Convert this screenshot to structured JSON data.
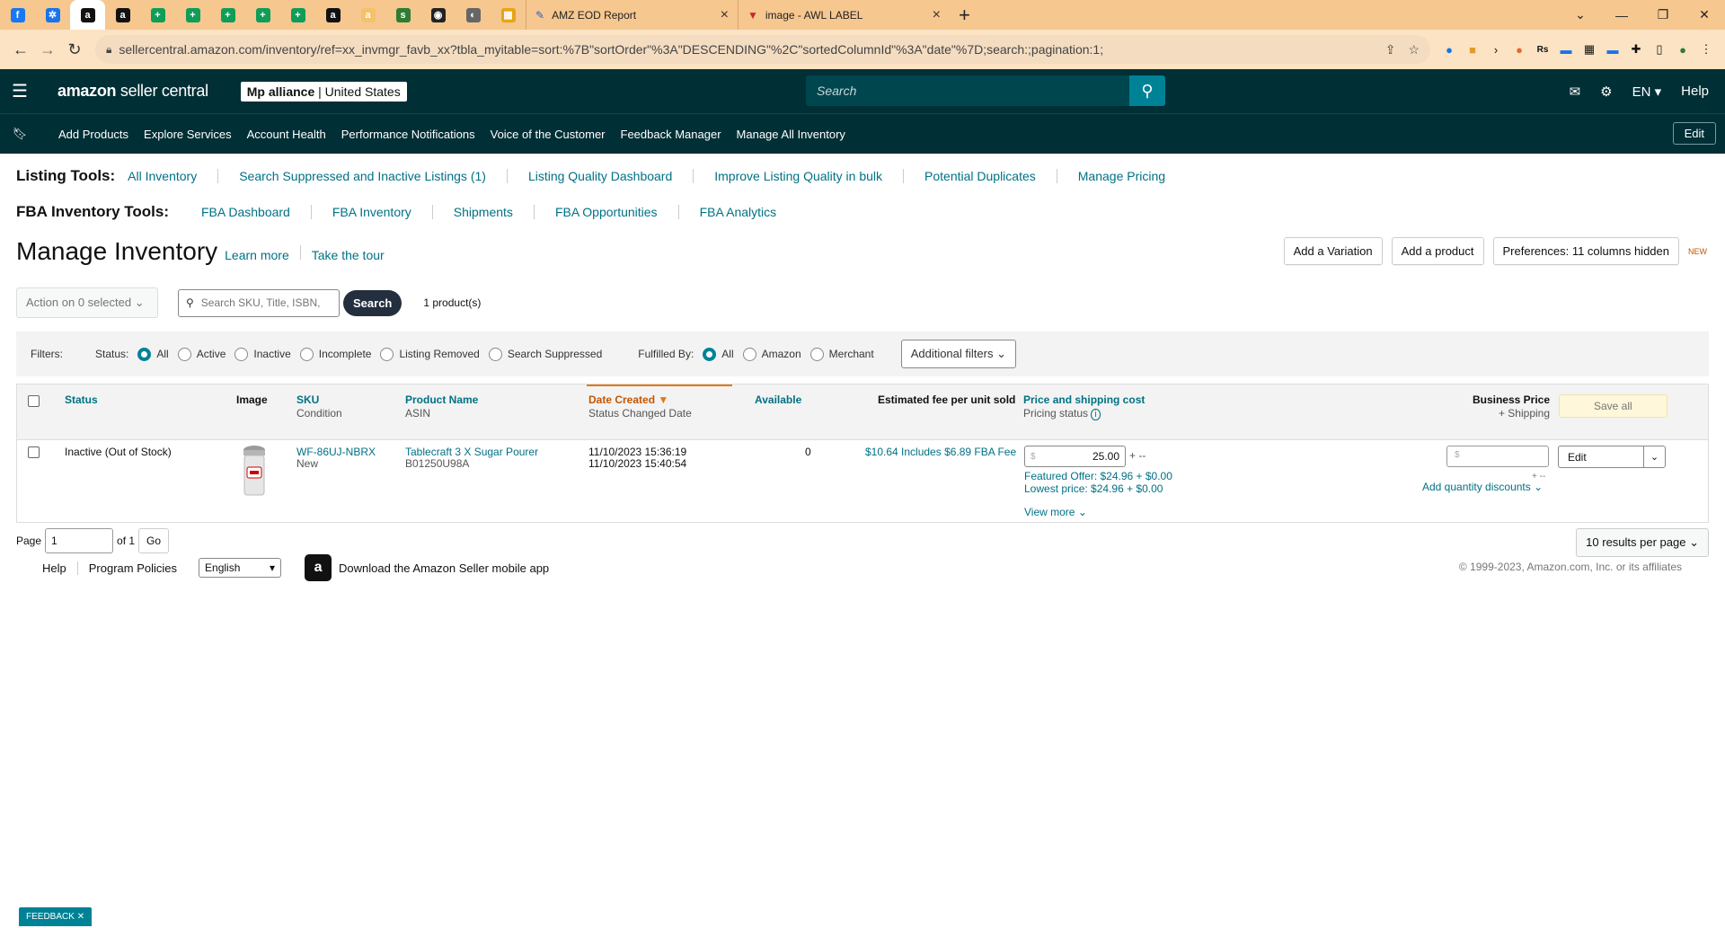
{
  "browser": {
    "tabs": [
      {
        "icon": "f",
        "color": "#1877f2"
      },
      {
        "icon": "✲",
        "color": "#1a73e8"
      },
      {
        "icon": "a",
        "color": "#111111",
        "active": true
      },
      {
        "icon": "a",
        "color": "#111111"
      },
      {
        "icon": "+",
        "color": "#0f9d58"
      },
      {
        "icon": "+",
        "color": "#0f9d58"
      },
      {
        "icon": "+",
        "color": "#0f9d58"
      },
      {
        "icon": "+",
        "color": "#0f9d58"
      },
      {
        "icon": "+",
        "color": "#0f9d58"
      },
      {
        "icon": "a",
        "color": "#111111"
      },
      {
        "icon": "a",
        "color": "#f5c26b"
      },
      {
        "icon": "s",
        "color": "#2e7d32"
      },
      {
        "icon": "◉",
        "color": "#222222"
      },
      {
        "icon": "◐",
        "color": "#666666"
      },
      {
        "icon": "▦",
        "color": "#e8a317"
      }
    ],
    "named_tabs": [
      {
        "title": "AMZ EOD Report"
      },
      {
        "title": "image - AWL LABEL"
      }
    ],
    "url": "sellercentral.amazon.com/inventory/ref=xx_invmgr_favb_xx?tbla_myitable=sort:%7B\"sortOrder\"%3A\"DESCENDING\"%2C\"sortedColumnId\"%3A\"date\"%7D;search:;pagination:1;"
  },
  "header": {
    "brand_bold": "amazon",
    "brand_light": "seller central",
    "store_name": "Mp alliance",
    "store_region": "United States",
    "search_placeholder": "Search",
    "lang": "EN",
    "help": "Help"
  },
  "subnav": {
    "items": [
      "Add Products",
      "Explore Services",
      "Account Health",
      "Performance Notifications",
      "Voice of the Customer",
      "Feedback Manager",
      "Manage All Inventory"
    ],
    "edit": "Edit"
  },
  "listing_tools": {
    "label": "Listing Tools:",
    "links": [
      "All Inventory",
      "Search Suppressed and Inactive Listings (1)",
      "Listing Quality Dashboard",
      "Improve Listing Quality in bulk",
      "Potential Duplicates",
      "Manage Pricing"
    ]
  },
  "fba_tools": {
    "label": "FBA Inventory Tools:",
    "links": [
      "FBA Dashboard",
      "FBA Inventory",
      "Shipments",
      "FBA Opportunities",
      "FBA Analytics"
    ]
  },
  "page": {
    "title": "Manage Inventory",
    "learn_more": "Learn more",
    "take_tour": "Take the tour",
    "add_variation": "Add a Variation",
    "add_product": "Add a product",
    "preferences": "Preferences: 11 columns hidden",
    "new_badge": "NEW"
  },
  "actions": {
    "action_select": "Action on 0 selected",
    "search_placeholder": "Search SKU, Title, ISBN,",
    "search_button": "Search",
    "product_count": "1 product(s)"
  },
  "filters": {
    "label": "Filters:",
    "status_label": "Status:",
    "status_options": [
      "All",
      "Active",
      "Inactive",
      "Incomplete",
      "Listing Removed",
      "Search Suppressed"
    ],
    "fulfilled_label": "Fulfilled By:",
    "fulfilled_options": [
      "All",
      "Amazon",
      "Merchant"
    ],
    "additional": "Additional filters"
  },
  "table": {
    "headers": {
      "status": "Status",
      "image": "Image",
      "sku": "SKU",
      "condition": "Condition",
      "product_name": "Product Name",
      "asin": "ASIN",
      "date_created": "Date Created",
      "status_changed": "Status Changed Date",
      "available": "Available",
      "est_fee": "Estimated fee per unit sold",
      "price_shipping": "Price and shipping cost",
      "pricing_status": "Pricing status",
      "business_price": "Business Price",
      "plus_shipping": "+ Shipping",
      "save_all": "Save all"
    },
    "rows": [
      {
        "status": "Inactive (Out of Stock)",
        "sku": "WF-86UJ-NBRX",
        "condition": "New",
        "product_name": "Tablecraft 3 X Sugar Pourer",
        "asin": "B01250U98A",
        "date_created": "11/10/2023 15:36:19",
        "status_changed": "11/10/2023 15:40:54",
        "available": "0",
        "est_fee": "$10.64 Includes $6.89 FBA Fee",
        "currency": "$",
        "price": "25.00",
        "shipping_suffix": "+ --",
        "featured_offer": "Featured Offer: $24.96 + $0.00",
        "lowest_price": "Lowest price: $24.96 + $0.00",
        "view_more": "View more",
        "business_suffix": "+ --",
        "qty_discounts": "Add quantity discounts",
        "edit": "Edit"
      }
    ]
  },
  "pagination": {
    "page_label": "Page",
    "page": "1",
    "of": "of 1",
    "go": "Go",
    "per_page": "10 results per page"
  },
  "footer": {
    "links": [
      "Help",
      "Program Policies"
    ],
    "language": "English",
    "app_promo": "Download the Amazon Seller mobile app",
    "copyright": "© 1999-2023, Amazon.com, Inc. or its affiliates"
  },
  "feedback": "FEEDBACK"
}
